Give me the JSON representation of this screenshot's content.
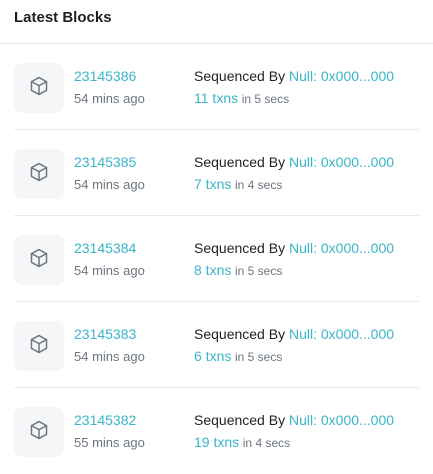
{
  "header": {
    "title": "Latest Blocks"
  },
  "blocks": [
    {
      "number": "23145386",
      "age": "54 mins ago",
      "sequenced_label": "Sequenced By",
      "sequencer": "Null: 0x000...000",
      "txns": "11 txns",
      "duration": "in 5 secs",
      "icon": "cube-icon"
    },
    {
      "number": "23145385",
      "age": "54 mins ago",
      "sequenced_label": "Sequenced By",
      "sequencer": "Null: 0x000...000",
      "txns": "7 txns",
      "duration": "in 4 secs",
      "icon": "cube-icon"
    },
    {
      "number": "23145384",
      "age": "54 mins ago",
      "sequenced_label": "Sequenced By",
      "sequencer": "Null: 0x000...000",
      "txns": "8 txns",
      "duration": "in 5 secs",
      "icon": "cube-icon"
    },
    {
      "number": "23145383",
      "age": "54 mins ago",
      "sequenced_label": "Sequenced By",
      "sequencer": "Null: 0x000...000",
      "txns": "6 txns",
      "duration": "in 5 secs",
      "icon": "cube-icon"
    },
    {
      "number": "23145382",
      "age": "55 mins ago",
      "sequenced_label": "Sequenced By",
      "sequencer": "Null: 0x000...000",
      "txns": "19 txns",
      "duration": "in 4 secs",
      "icon": "cube-icon"
    }
  ],
  "colors": {
    "link": "#3ab5c9",
    "muted": "#6c757e",
    "text": "#1e2022",
    "icon_bg": "#f5f6f8",
    "divider": "#e7eaf3"
  }
}
